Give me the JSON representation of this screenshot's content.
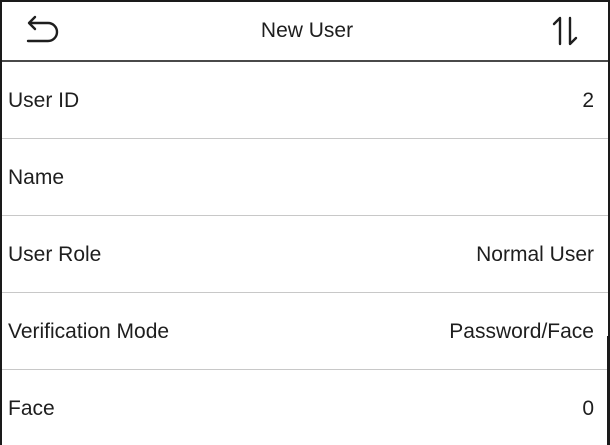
{
  "header": {
    "title": "New User",
    "back_icon": "back-arrow-icon",
    "sort_icon": "sort-up-down-icon"
  },
  "rows": [
    {
      "label": "User ID",
      "value": "2"
    },
    {
      "label": "Name",
      "value": ""
    },
    {
      "label": "User Role",
      "value": "Normal User"
    },
    {
      "label": "Verification Mode",
      "value": "Password/Face"
    },
    {
      "label": "Face",
      "value": "0"
    }
  ],
  "colors": {
    "background": "#ffffff",
    "text": "#1e1e1e",
    "divider": "#c8c8c8",
    "frame": "#1a1a1a"
  }
}
